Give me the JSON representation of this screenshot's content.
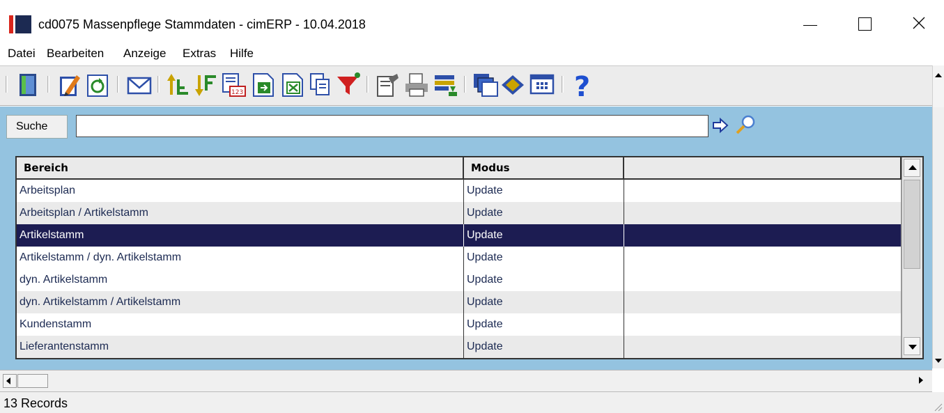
{
  "window": {
    "title": "cd0075 Massenpflege Stammdaten - cimERP - 10.04.2018"
  },
  "menu": [
    "Datei",
    "Bearbeiten",
    "Anzeige",
    "Extras",
    "Hilfe"
  ],
  "toolbar": {
    "buttons": [
      "exit-icon",
      "edit-icon",
      "refresh-icon",
      "mail-icon",
      "sort-ascending-icon",
      "sort-descending-icon",
      "number-format-icon",
      "export-icon",
      "excel-export-icon",
      "copy-icon",
      "filter-icon",
      "properties-icon",
      "print-icon",
      "list-transfer-icon",
      "windows-icon",
      "help-book-icon",
      "grid-layout-icon",
      "help-icon"
    ]
  },
  "search": {
    "label": "Suche",
    "value": ""
  },
  "grid": {
    "columns": [
      "Bereich",
      "Modus",
      ""
    ],
    "rows": [
      {
        "bereich": "Arbeitsplan",
        "modus": "Update",
        "selected": false
      },
      {
        "bereich": "Arbeitsplan / Artikelstamm",
        "modus": "Update",
        "selected": false
      },
      {
        "bereich": "Artikelstamm",
        "modus": "Update",
        "selected": true
      },
      {
        "bereich": "Artikelstamm / dyn. Artikelstamm",
        "modus": "Update",
        "selected": false
      },
      {
        "bereich": "dyn. Artikelstamm",
        "modus": "Update",
        "selected": false
      },
      {
        "bereich": "dyn. Artikelstamm / Artikelstamm",
        "modus": "Update",
        "selected": false
      },
      {
        "bereich": "Kundenstamm",
        "modus": "Update",
        "selected": false
      },
      {
        "bereich": "Lieferantenstamm",
        "modus": "Update",
        "selected": false
      }
    ]
  },
  "status": {
    "records": "13 Records"
  },
  "colors": {
    "panel": "#94c3e0",
    "selection": "#1c1c52",
    "rowText": "#1c2a52"
  }
}
